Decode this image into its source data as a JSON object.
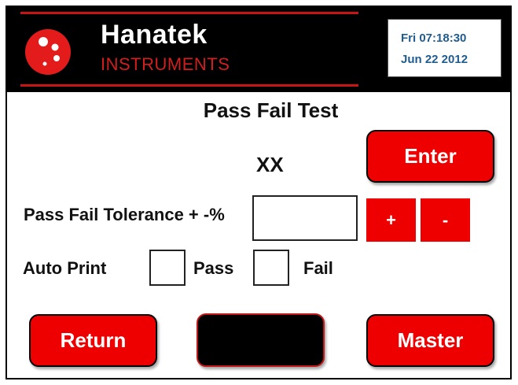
{
  "header": {
    "brand_name": "Hanatek",
    "brand_sub": "INSTRUMENTS",
    "time": "Fri 07:18:30",
    "date": "Jun 22 2012",
    "logo_icon": "hanatek-logo-icon"
  },
  "main": {
    "title": "Pass Fail Test",
    "value_readout": "XX",
    "enter_label": "Enter",
    "tolerance_label": "Pass Fail Tolerance + -%",
    "tolerance_value": "",
    "plus_label": "+",
    "minus_label": "-",
    "auto_print_label": "Auto Print",
    "pass_label": "Pass",
    "fail_label": "Fail",
    "pass_checked": false,
    "fail_checked": false
  },
  "footer": {
    "return_label": "Return",
    "middle_label": "",
    "master_label": "Master"
  },
  "colors": {
    "accent_red": "#ee0000",
    "header_black": "#000000",
    "date_blue": "#1f5c8f"
  }
}
